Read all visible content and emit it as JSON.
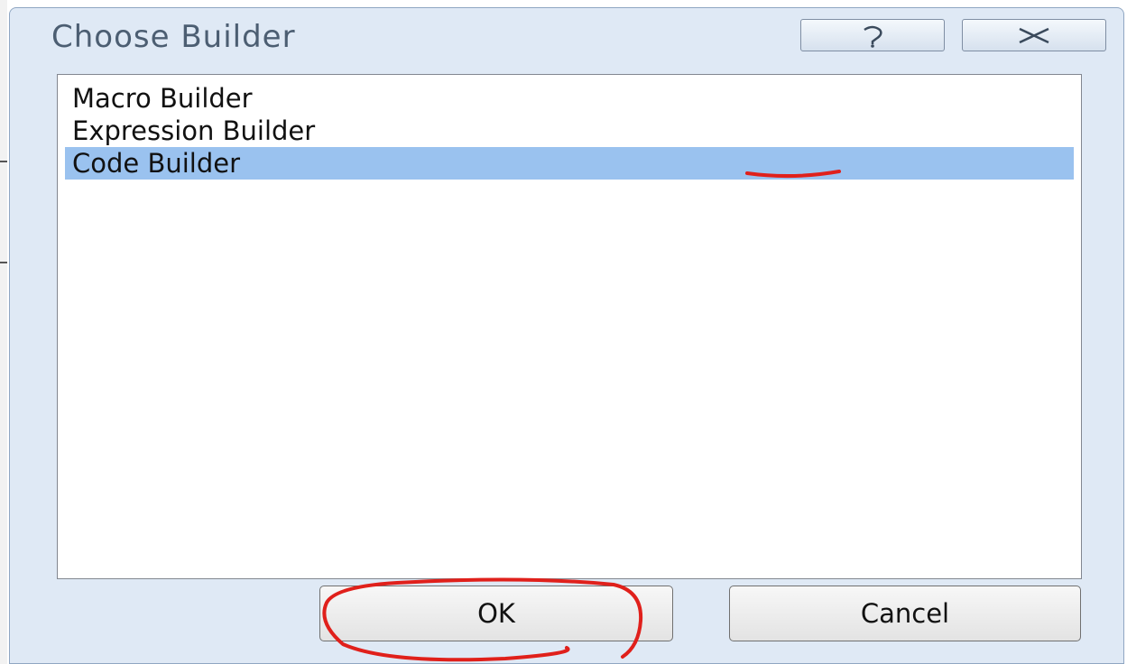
{
  "dialog": {
    "title": "Choose Builder",
    "caption_buttons": {
      "help_icon": "help-question-icon",
      "close_icon": "close-x-icon"
    }
  },
  "list": {
    "items": [
      {
        "label": "Macro Builder",
        "selected": false
      },
      {
        "label": "Expression Builder",
        "selected": false
      },
      {
        "label": "Code Builder",
        "selected": true
      }
    ]
  },
  "buttons": {
    "ok_label": "OK",
    "cancel_label": "Cancel"
  },
  "colors": {
    "dialog_background": "#dfe9f5",
    "selection_highlight": "#9ac2ef",
    "annotation_ink": "#e0201b"
  }
}
